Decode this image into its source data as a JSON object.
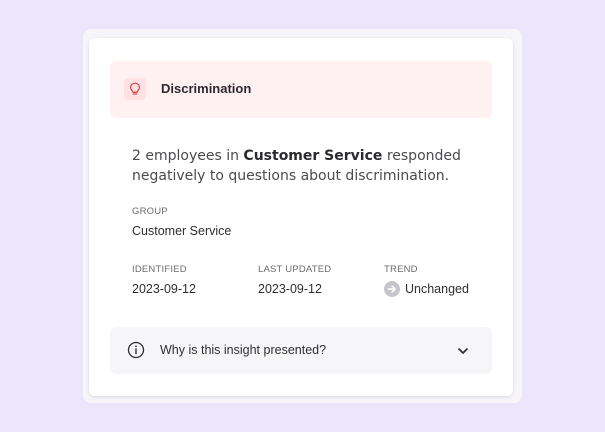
{
  "insight": {
    "title": "Discrimination",
    "icon": "lightbulb-icon",
    "accent_color": "#e0444f",
    "description": {
      "prefix": "2 employees in ",
      "group_bold": "Customer Service",
      "suffix": " responded negatively to questions about discrimination."
    },
    "group": {
      "label": "GROUP",
      "value": "Customer Service"
    },
    "identified": {
      "label": "IDENTIFIED",
      "value": "2023-09-12"
    },
    "last_updated": {
      "label": "LAST UPDATED",
      "value": "2023-09-12"
    },
    "trend": {
      "label": "TREND",
      "value": "Unchanged",
      "icon": "arrow-right-circle-icon"
    },
    "faq": {
      "label": "Why is this insight presented?",
      "icon": "info-icon",
      "expand_icon": "chevron-down-icon"
    }
  }
}
